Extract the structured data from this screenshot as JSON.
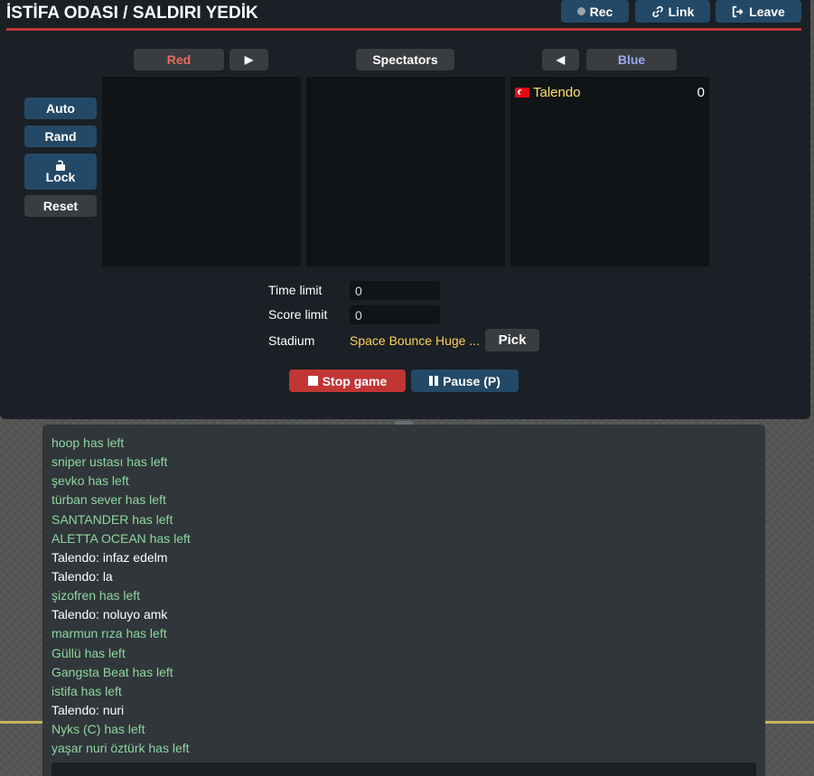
{
  "room": {
    "title": "İSTİFA ODASI / SALDIRI YEDİK",
    "buttons": {
      "rec": "Rec",
      "link": "Link",
      "leave": "Leave"
    }
  },
  "teams": {
    "red": {
      "label": "Red",
      "color": "#ed6a5a",
      "players": []
    },
    "spectators": {
      "label": "Spectators",
      "players": []
    },
    "blue": {
      "label": "Blue",
      "color": "#9aa7f0",
      "players": [
        {
          "name": "Talendo",
          "score": "0",
          "flag": "tr-flag-icon"
        }
      ]
    },
    "move_right_arrow": "▶",
    "move_left_arrow": "◀"
  },
  "side_buttons": {
    "auto": "Auto",
    "rand": "Rand",
    "lock": "Lock",
    "reset": "Reset"
  },
  "settings": {
    "time_limit_label": "Time limit",
    "time_limit_value": "0",
    "score_limit_label": "Score limit",
    "score_limit_value": "0",
    "stadium_label": "Stadium",
    "stadium_value": "Space Bounce Huge ...",
    "pick_label": "Pick"
  },
  "game_controls": {
    "stop": "Stop game",
    "pause": "Pause (P)"
  },
  "colors": {
    "stop": "#c13535",
    "pause": "#244967",
    "accent_line": "#c13535"
  },
  "chat": {
    "lines": [
      {
        "text": "hoop has left",
        "kind": "notice"
      },
      {
        "text": "sniper ustası has left",
        "kind": "notice"
      },
      {
        "text": "şevko has left",
        "kind": "notice"
      },
      {
        "text": "türban sever has left",
        "kind": "notice"
      },
      {
        "text": "SANTANDER has left",
        "kind": "notice"
      },
      {
        "text": "ALETTA OCEAN has left",
        "kind": "notice"
      },
      {
        "text": "Talendo: infaz edelm",
        "kind": "message"
      },
      {
        "text": "Talendo: la",
        "kind": "message"
      },
      {
        "text": "şizofren has left",
        "kind": "notice"
      },
      {
        "text": "Talendo: noluyo amk",
        "kind": "message"
      },
      {
        "text": "marmun rıza has left",
        "kind": "notice"
      },
      {
        "text": "Güllü has left",
        "kind": "notice"
      },
      {
        "text": "Gangsta Beat has left",
        "kind": "notice"
      },
      {
        "text": "istifa has left",
        "kind": "notice"
      },
      {
        "text": "Talendo: nuri",
        "kind": "message"
      },
      {
        "text": "Nyks (C) has left",
        "kind": "notice"
      },
      {
        "text": "yaşar nuri öztürk has left",
        "kind": "notice"
      }
    ],
    "input_placeholder": ""
  }
}
